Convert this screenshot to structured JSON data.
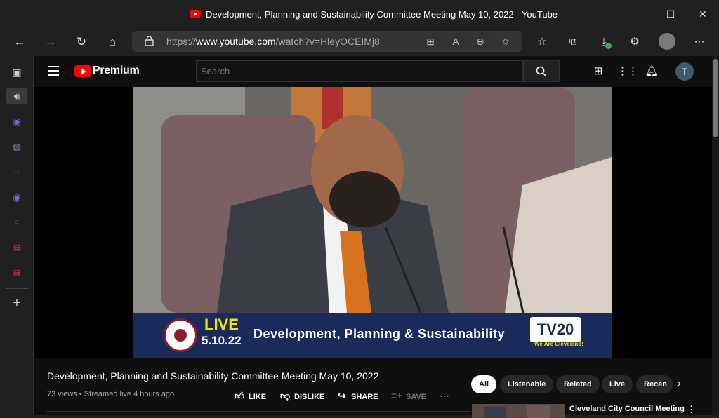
{
  "window": {
    "title": "Development, Planning and Sustainability Committee Meeting May 10, 2022 - YouTube",
    "min": "—",
    "max": "☐",
    "close": "✕"
  },
  "toolbar": {
    "url_prefix": "https://",
    "url_host": "www.youtube.com",
    "url_path": "/watch?v=HleyOCEIMj8",
    "back": "←",
    "forward": "→",
    "refresh": "↻",
    "home": "⌂"
  },
  "youtube": {
    "brand": "Premium",
    "search_placeholder": "Search",
    "avatar_letter": "T",
    "video": {
      "banner_live": "LIVE",
      "banner_date": "5.10.22",
      "banner_text": "Development, Planning & Sustainability",
      "banner_channel": "TV20",
      "banner_channel_sub": "We Are Cleveland!"
    },
    "title": "Development, Planning and Sustainability Committee Meeting May 10, 2022",
    "meta": "73 views • Streamed live 4 hours ago",
    "actions": {
      "like": "LIKE",
      "dislike": "DISLIKE",
      "share": "SHARE",
      "save": "SAVE"
    },
    "chips": [
      "All",
      "Listenable",
      "Related",
      "Live",
      "Recen"
    ],
    "recommended": [
      {
        "title": "Cleveland City Council Meeting"
      }
    ]
  },
  "colors": {
    "accent": "#ff0000",
    "banner": "#1a2a5a",
    "live": "#f2e600"
  }
}
